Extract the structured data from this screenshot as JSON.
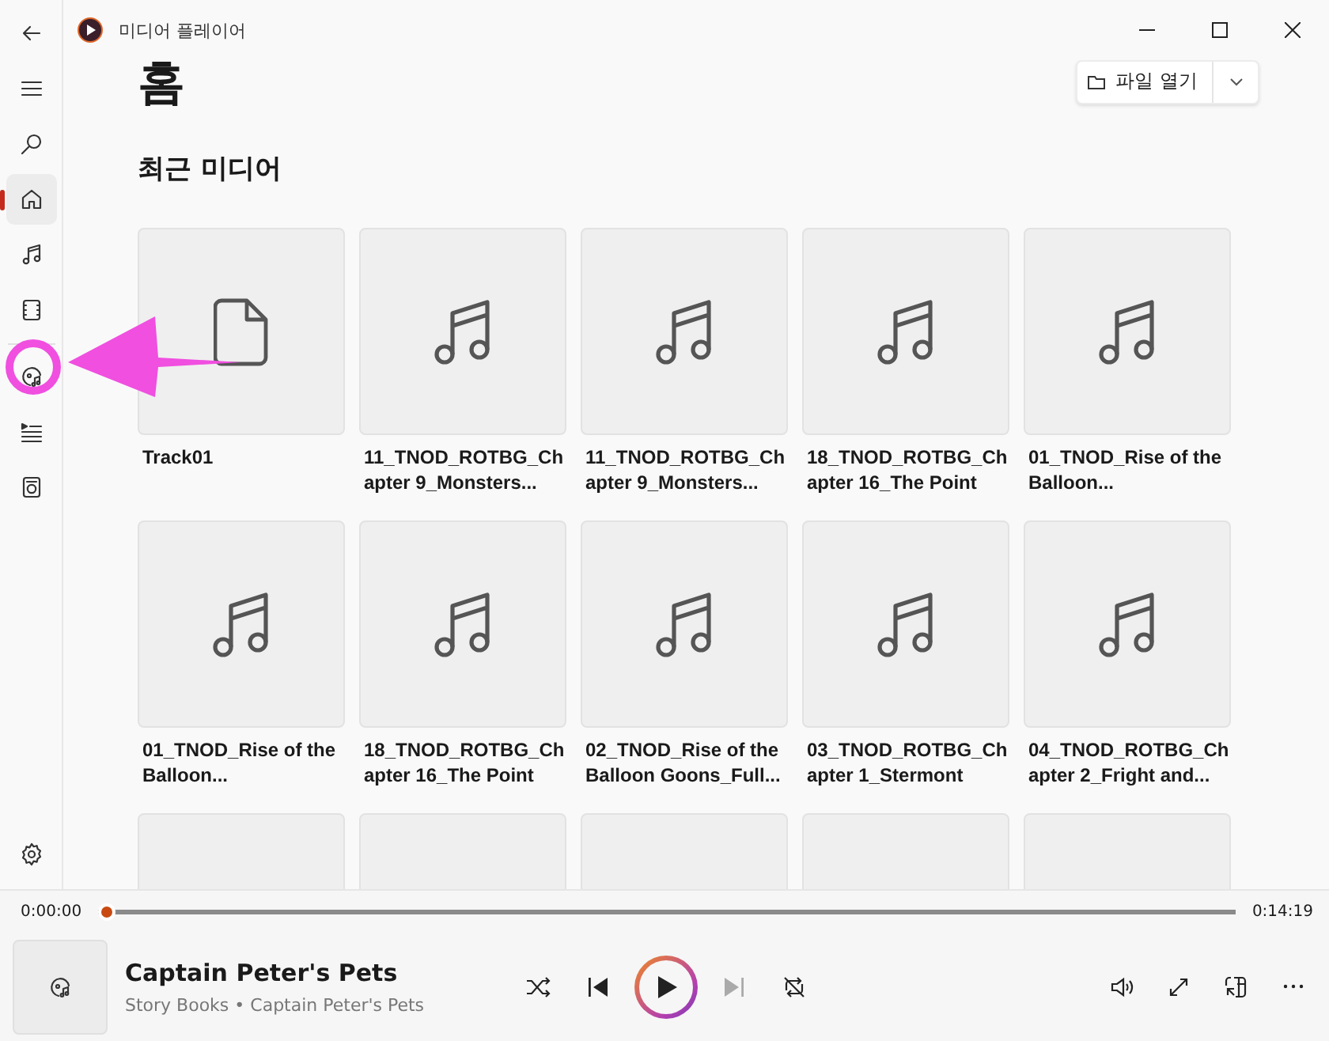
{
  "window": {
    "title": "미디어 플레이어"
  },
  "nav": {
    "top": [
      {
        "kind": "back",
        "selected": false
      },
      {
        "kind": "menu",
        "selected": false
      },
      {
        "kind": "search",
        "selected": false
      }
    ],
    "main": [
      {
        "kind": "home",
        "selected": true
      },
      {
        "kind": "music",
        "selected": false
      },
      {
        "kind": "video",
        "selected": false
      }
    ],
    "tools": [
      {
        "kind": "now-playing",
        "selected": false
      },
      {
        "kind": "queue",
        "selected": false
      },
      {
        "kind": "device",
        "selected": false
      }
    ],
    "bottom": [
      {
        "kind": "settings",
        "selected": false
      }
    ]
  },
  "page_title": "홈",
  "open_file_button": {
    "label": "파일 열기"
  },
  "section_title": "최근 미디어",
  "recent_media": [
    {
      "kind": "file",
      "title": "Track01"
    },
    {
      "kind": "music",
      "title": "11_TNOD_ROTBG_Chapter 9_Monsters..."
    },
    {
      "kind": "music",
      "title": "11_TNOD_ROTBG_Chapter 9_Monsters..."
    },
    {
      "kind": "music",
      "title": "18_TNOD_ROTBG_Chapter 16_The Point"
    },
    {
      "kind": "music",
      "title": "01_TNOD_Rise of the Balloon..."
    },
    {
      "kind": "music",
      "title": "01_TNOD_Rise of the Balloon..."
    },
    {
      "kind": "music",
      "title": "18_TNOD_ROTBG_Chapter 16_The Point"
    },
    {
      "kind": "music",
      "title": "02_TNOD_Rise of the Balloon Goons_Full..."
    },
    {
      "kind": "music",
      "title": "03_TNOD_ROTBG_Chapter 1_Stermont"
    },
    {
      "kind": "music",
      "title": "04_TNOD_ROTBG_Chapter 2_Fright and..."
    },
    {
      "kind": "hidden"
    },
    {
      "kind": "hidden"
    },
    {
      "kind": "hidden"
    },
    {
      "kind": "hidden"
    },
    {
      "kind": "hidden"
    }
  ],
  "player": {
    "elapsed": "0:00:00",
    "duration": "0:14:19",
    "level": 0,
    "title": "Captain Peter's Pets",
    "subtitle": "Story Books • Captain Peter's Pets",
    "controls": [
      {
        "kind": "shuffle",
        "disabled": false
      },
      {
        "kind": "previous",
        "disabled": false
      },
      {
        "kind": "play",
        "disabled": false
      },
      {
        "kind": "next",
        "disabled": true
      },
      {
        "kind": "repeat",
        "disabled": false
      }
    ],
    "actions": [
      {
        "kind": "volume"
      },
      {
        "kind": "fullscreen"
      },
      {
        "kind": "mini-player"
      },
      {
        "kind": "more"
      }
    ]
  }
}
